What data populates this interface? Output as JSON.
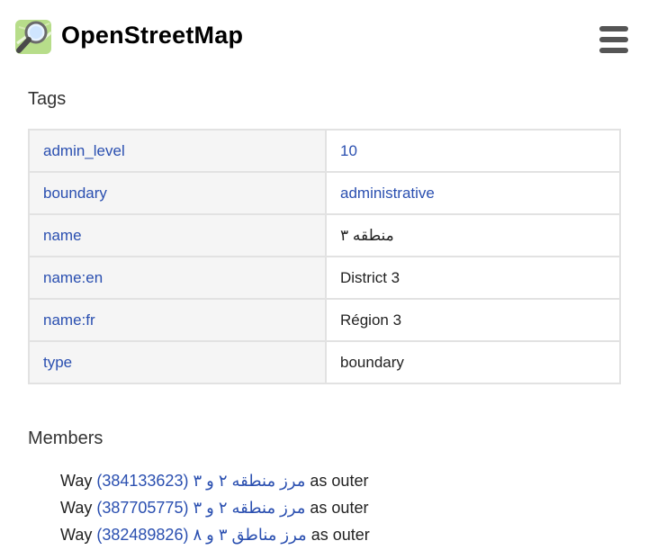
{
  "header": {
    "brand": "OpenStreetMap",
    "logo_icon": "magnifier-map-logo",
    "menu_icon": "hamburger-menu-icon"
  },
  "tags": {
    "title": "Tags",
    "rows": [
      {
        "key": "admin_level",
        "value": "10",
        "value_is_link": true
      },
      {
        "key": "boundary",
        "value": "administrative",
        "value_is_link": true
      },
      {
        "key": "name",
        "value": "منطقه ۳",
        "value_is_link": false
      },
      {
        "key": "name:en",
        "value": "District 3",
        "value_is_link": false
      },
      {
        "key": "name:fr",
        "value": "Région 3",
        "value_is_link": false
      },
      {
        "key": "type",
        "value": "boundary",
        "value_is_link": false
      }
    ]
  },
  "members": {
    "title": "Members",
    "items": [
      {
        "type": "Way",
        "link_text": "مرز منطقه ۲ و ۳ (384133623)",
        "role_text": "as outer"
      },
      {
        "type": "Way",
        "link_text": "مرز منطقه ۲ و ۳ (387705775)",
        "role_text": "as outer"
      },
      {
        "type": "Way",
        "link_text": "مرز مناطق ۳ و ۸ (382489826)",
        "role_text": "as outer"
      }
    ]
  },
  "colors": {
    "link": "#2a4fb0",
    "key_cell_bg": "#f5f5f5",
    "border": "#e2e2e2"
  }
}
